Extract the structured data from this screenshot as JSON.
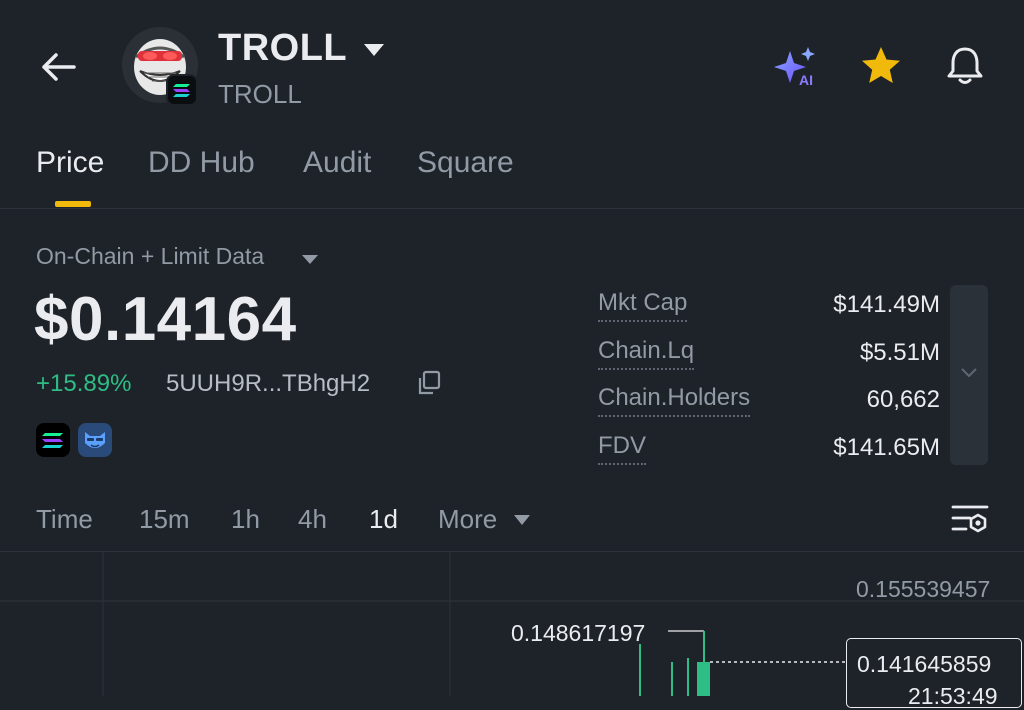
{
  "header": {
    "title": "TROLL",
    "subtitle": "TROLL"
  },
  "tabs": [
    {
      "label": "Price",
      "active": true
    },
    {
      "label": "DD Hub",
      "active": false
    },
    {
      "label": "Audit",
      "active": false
    },
    {
      "label": "Square",
      "active": false
    }
  ],
  "market": {
    "data_source": "On-Chain + Limit Data",
    "price": "$0.14164",
    "change": "+15.89%",
    "contract": "5UUH9R...TBhgH2"
  },
  "stats": [
    {
      "label": "Mkt Cap",
      "value": "$141.49M"
    },
    {
      "label": "Chain.Lq",
      "value": "$5.51M"
    },
    {
      "label": "Chain.Holders",
      "value": "60,662"
    },
    {
      "label": "FDV",
      "value": "$141.65M"
    }
  ],
  "timeframes": {
    "time": "Time",
    "items": [
      "15m",
      "1h",
      "4h",
      "1d"
    ],
    "active": "1d",
    "more": "More"
  },
  "chart": {
    "axis_top": "0.155539457",
    "high_label": "0.148617197",
    "current_price": "0.141645859",
    "current_time": "21:53:49"
  },
  "icons": {
    "back": "arrow-left-icon",
    "ai": "ai-sparkle-icon",
    "favorite": "star-icon",
    "alert": "bell-icon",
    "copy": "copy-icon",
    "chart_settings": "chart-settings-icon"
  },
  "colors": {
    "background": "#1e2329",
    "accent": "#f0b90b",
    "up": "#2ebd85",
    "muted_text": "#929aa5"
  }
}
